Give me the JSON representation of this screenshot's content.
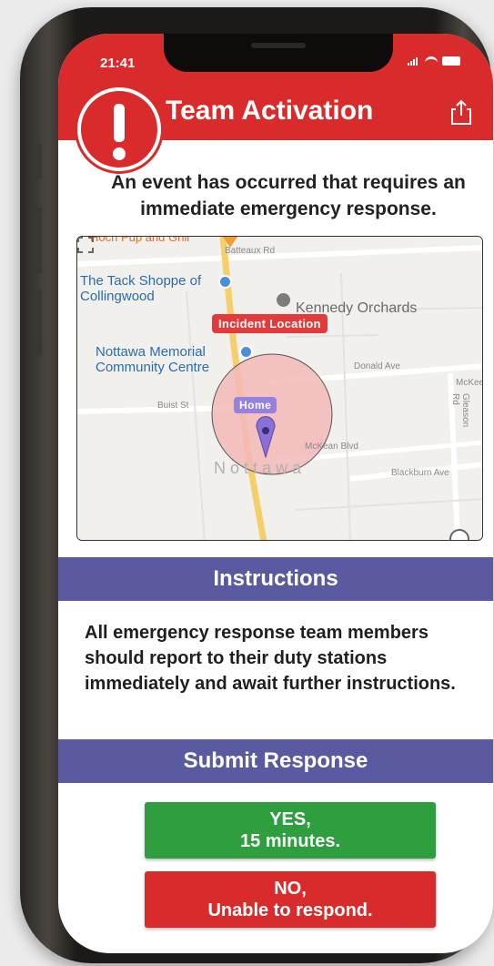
{
  "status_bar": {
    "time": "21:41"
  },
  "header": {
    "title": "Team Activation",
    "alert_icon": "exclamation-icon",
    "share_icon": "share-icon"
  },
  "intro": "An event has occurred that requires an immediate emergency response.",
  "map": {
    "places": {
      "tack_shoppe": "The Tack Shoppe of Collingwood",
      "kennedy_orchards": "Kennedy Orchards",
      "nottawa_memorial": "Nottawa Memorial Community Centre",
      "cropped_top": "Hoch Pup and Grill"
    },
    "streets": {
      "batteaux": "Batteaux Rd",
      "donald": "Donald Ave",
      "mckean": "McKean Blvd",
      "blackburn": "Blackburn Ave",
      "gleason": "Gleason Rd",
      "buist": "Buist St",
      "mckee": "McKee"
    },
    "town": "Nottawa",
    "incident_label": "Incident Location",
    "home_label": "Home",
    "colors": {
      "incident": "#e23b3b",
      "home_pin": "#8a6fd6",
      "radius_fill": "#f5b8b8"
    }
  },
  "instructions": {
    "header": "Instructions",
    "body": "All emergency response team members should report to their duty stations immediately and await further instructions."
  },
  "submit": {
    "header": "Submit Response",
    "yes_label": "YES,\n15 minutes.",
    "yes_line1": "YES,",
    "yes_line2": "15 minutes.",
    "no_line1": "NO,",
    "no_line2": "Unable to respond."
  },
  "colors": {
    "header_red": "#d92b2b",
    "section_blue": "#5a5aa0",
    "yes_green": "#2e9e3f",
    "no_red": "#d92b2b"
  }
}
